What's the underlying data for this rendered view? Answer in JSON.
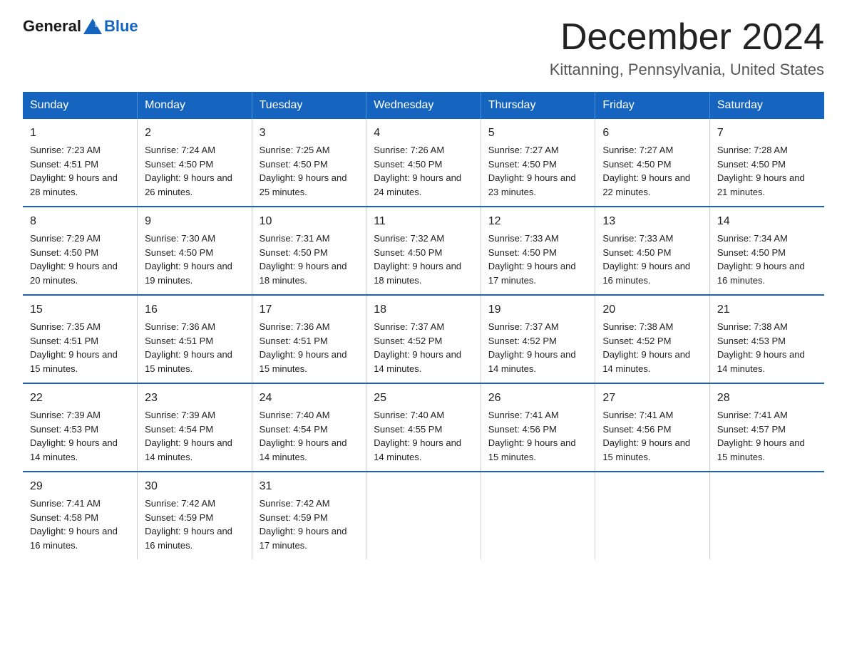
{
  "logo": {
    "text_general": "General",
    "text_blue": "Blue"
  },
  "header": {
    "month_year": "December 2024",
    "location": "Kittanning, Pennsylvania, United States"
  },
  "days_of_week": [
    "Sunday",
    "Monday",
    "Tuesday",
    "Wednesday",
    "Thursday",
    "Friday",
    "Saturday"
  ],
  "weeks": [
    [
      {
        "day": "1",
        "sunrise": "7:23 AM",
        "sunset": "4:51 PM",
        "daylight": "9 hours and 28 minutes."
      },
      {
        "day": "2",
        "sunrise": "7:24 AM",
        "sunset": "4:50 PM",
        "daylight": "9 hours and 26 minutes."
      },
      {
        "day": "3",
        "sunrise": "7:25 AM",
        "sunset": "4:50 PM",
        "daylight": "9 hours and 25 minutes."
      },
      {
        "day": "4",
        "sunrise": "7:26 AM",
        "sunset": "4:50 PM",
        "daylight": "9 hours and 24 minutes."
      },
      {
        "day": "5",
        "sunrise": "7:27 AM",
        "sunset": "4:50 PM",
        "daylight": "9 hours and 23 minutes."
      },
      {
        "day": "6",
        "sunrise": "7:27 AM",
        "sunset": "4:50 PM",
        "daylight": "9 hours and 22 minutes."
      },
      {
        "day": "7",
        "sunrise": "7:28 AM",
        "sunset": "4:50 PM",
        "daylight": "9 hours and 21 minutes."
      }
    ],
    [
      {
        "day": "8",
        "sunrise": "7:29 AM",
        "sunset": "4:50 PM",
        "daylight": "9 hours and 20 minutes."
      },
      {
        "day": "9",
        "sunrise": "7:30 AM",
        "sunset": "4:50 PM",
        "daylight": "9 hours and 19 minutes."
      },
      {
        "day": "10",
        "sunrise": "7:31 AM",
        "sunset": "4:50 PM",
        "daylight": "9 hours and 18 minutes."
      },
      {
        "day": "11",
        "sunrise": "7:32 AM",
        "sunset": "4:50 PM",
        "daylight": "9 hours and 18 minutes."
      },
      {
        "day": "12",
        "sunrise": "7:33 AM",
        "sunset": "4:50 PM",
        "daylight": "9 hours and 17 minutes."
      },
      {
        "day": "13",
        "sunrise": "7:33 AM",
        "sunset": "4:50 PM",
        "daylight": "9 hours and 16 minutes."
      },
      {
        "day": "14",
        "sunrise": "7:34 AM",
        "sunset": "4:50 PM",
        "daylight": "9 hours and 16 minutes."
      }
    ],
    [
      {
        "day": "15",
        "sunrise": "7:35 AM",
        "sunset": "4:51 PM",
        "daylight": "9 hours and 15 minutes."
      },
      {
        "day": "16",
        "sunrise": "7:36 AM",
        "sunset": "4:51 PM",
        "daylight": "9 hours and 15 minutes."
      },
      {
        "day": "17",
        "sunrise": "7:36 AM",
        "sunset": "4:51 PM",
        "daylight": "9 hours and 15 minutes."
      },
      {
        "day": "18",
        "sunrise": "7:37 AM",
        "sunset": "4:52 PM",
        "daylight": "9 hours and 14 minutes."
      },
      {
        "day": "19",
        "sunrise": "7:37 AM",
        "sunset": "4:52 PM",
        "daylight": "9 hours and 14 minutes."
      },
      {
        "day": "20",
        "sunrise": "7:38 AM",
        "sunset": "4:52 PM",
        "daylight": "9 hours and 14 minutes."
      },
      {
        "day": "21",
        "sunrise": "7:38 AM",
        "sunset": "4:53 PM",
        "daylight": "9 hours and 14 minutes."
      }
    ],
    [
      {
        "day": "22",
        "sunrise": "7:39 AM",
        "sunset": "4:53 PM",
        "daylight": "9 hours and 14 minutes."
      },
      {
        "day": "23",
        "sunrise": "7:39 AM",
        "sunset": "4:54 PM",
        "daylight": "9 hours and 14 minutes."
      },
      {
        "day": "24",
        "sunrise": "7:40 AM",
        "sunset": "4:54 PM",
        "daylight": "9 hours and 14 minutes."
      },
      {
        "day": "25",
        "sunrise": "7:40 AM",
        "sunset": "4:55 PM",
        "daylight": "9 hours and 14 minutes."
      },
      {
        "day": "26",
        "sunrise": "7:41 AM",
        "sunset": "4:56 PM",
        "daylight": "9 hours and 15 minutes."
      },
      {
        "day": "27",
        "sunrise": "7:41 AM",
        "sunset": "4:56 PM",
        "daylight": "9 hours and 15 minutes."
      },
      {
        "day": "28",
        "sunrise": "7:41 AM",
        "sunset": "4:57 PM",
        "daylight": "9 hours and 15 minutes."
      }
    ],
    [
      {
        "day": "29",
        "sunrise": "7:41 AM",
        "sunset": "4:58 PM",
        "daylight": "9 hours and 16 minutes."
      },
      {
        "day": "30",
        "sunrise": "7:42 AM",
        "sunset": "4:59 PM",
        "daylight": "9 hours and 16 minutes."
      },
      {
        "day": "31",
        "sunrise": "7:42 AM",
        "sunset": "4:59 PM",
        "daylight": "9 hours and 17 minutes."
      },
      null,
      null,
      null,
      null
    ]
  ],
  "labels": {
    "sunrise": "Sunrise: ",
    "sunset": "Sunset: ",
    "daylight": "Daylight: "
  },
  "colors": {
    "header_bg": "#1565c0",
    "header_text": "#ffffff",
    "border_blue": "#1565c0"
  }
}
